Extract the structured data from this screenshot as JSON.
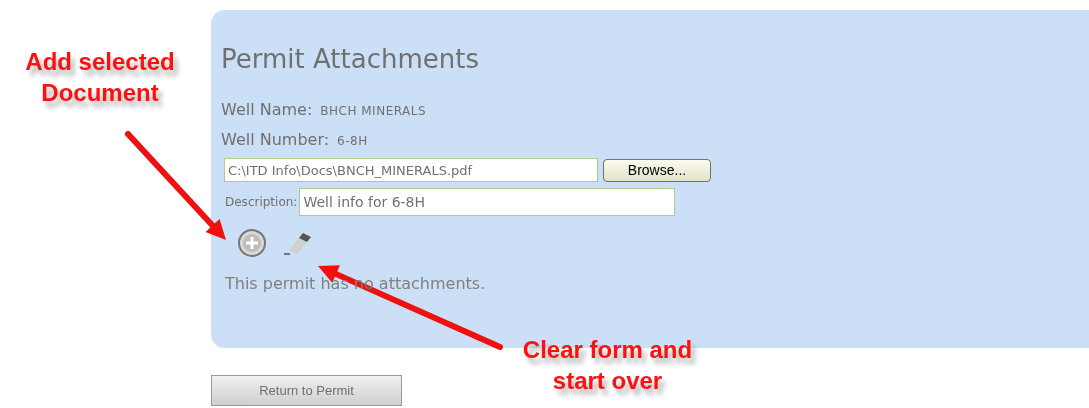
{
  "panel": {
    "title": "Permit Attachments",
    "fields": [
      {
        "label": "Well Name:",
        "value": "BHCH MINERALS"
      },
      {
        "label": "Well Number:",
        "value": "6-8H"
      }
    ],
    "file_input": {
      "value": "C:\\ITD Info\\Docs\\BNCH_MINERALS.pdf",
      "button": "Browse..."
    },
    "description": {
      "label": "Description:",
      "value": "Well info for 6-8H"
    },
    "message": "This permit has no attachments."
  },
  "return_button": "Return to Permit",
  "annotations": [
    {
      "text": "Add selected Document"
    },
    {
      "text": "Clear form and start over"
    }
  ]
}
